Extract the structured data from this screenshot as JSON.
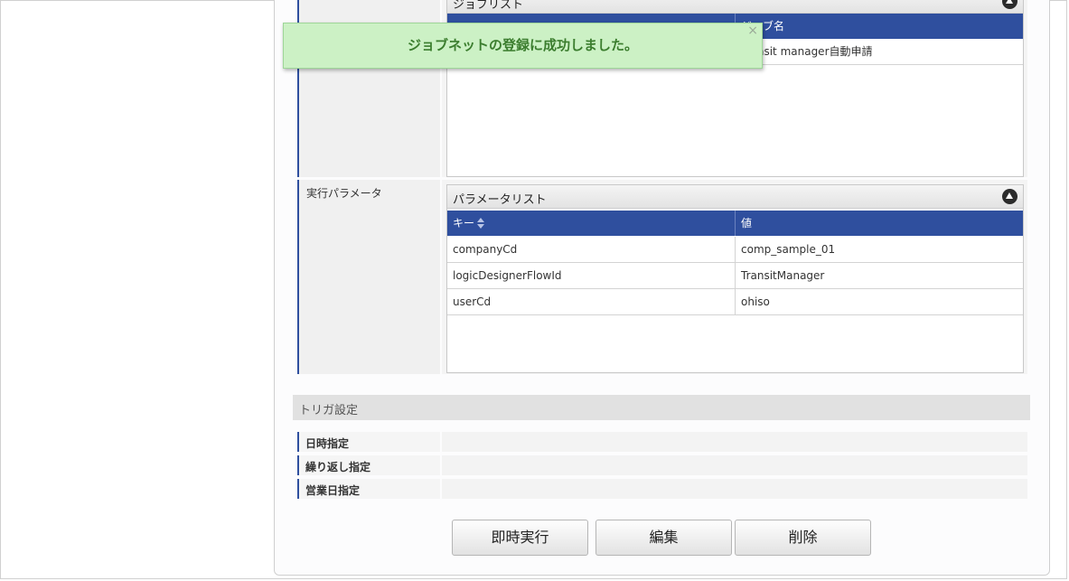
{
  "colors": {
    "accent": "#2f4f9e",
    "toast_bg": "#ccf1c5",
    "toast_text": "#3b7d2e"
  },
  "job_list": {
    "title": "ジョブリスト",
    "columns": [
      "ジョブ名"
    ],
    "rows": [
      {
        "job_name": "Transit manager自動申請"
      }
    ]
  },
  "params": {
    "label": "実行パラメータ",
    "title": "パラメータリスト",
    "columns": [
      "キー",
      "値"
    ],
    "rows": [
      {
        "key": "companyCd",
        "value": "comp_sample_01"
      },
      {
        "key": "logicDesignerFlowId",
        "value": "TransitManager"
      },
      {
        "key": "userCd",
        "value": "ohiso"
      }
    ]
  },
  "trigger": {
    "title": "トリガ設定",
    "rows": [
      {
        "label": "日時指定",
        "value": ""
      },
      {
        "label": "繰り返し指定",
        "value": ""
      },
      {
        "label": "営業日指定",
        "value": ""
      }
    ]
  },
  "buttons": {
    "run_now": "即時実行",
    "edit": "編集",
    "delete": "削除"
  },
  "toast": {
    "message": "ジョブネットの登録に成功しました。",
    "close": "×"
  }
}
